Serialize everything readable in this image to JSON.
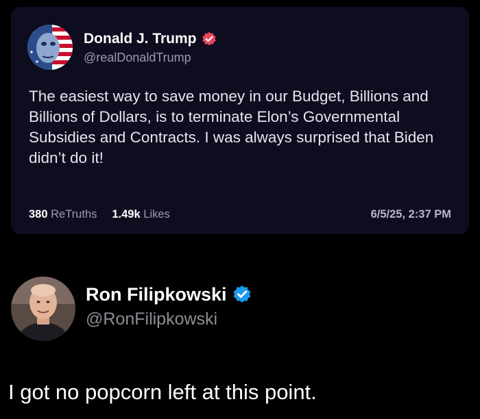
{
  "truth_post": {
    "author_name": "Donald J. Trump",
    "author_handle": "@realDonaldTrump",
    "verified_icon": "verified-badge-icon",
    "body": "The easiest way to save money in our Budget, Billions and Billions of Dollars, is to terminate Elon’s Governmental Subsidies and Contracts. I was always surprised that Biden didn’t do it!",
    "retruths_count": "380",
    "retruths_label": "ReTruths",
    "likes_count": "1.49k",
    "likes_label": "Likes",
    "timestamp": "6/5/25, 2:37 PM",
    "colors": {
      "card_background": "#0e0c1f",
      "verified_badge": "#e8475b"
    }
  },
  "quote_post": {
    "author_name": "Ron Filipkowski",
    "author_handle": "@RonFilipkowski",
    "verified_icon": "verified-badge-icon",
    "text": "I got no popcorn left at this point.",
    "colors": {
      "verified_badge": "#1d9bf0"
    }
  }
}
